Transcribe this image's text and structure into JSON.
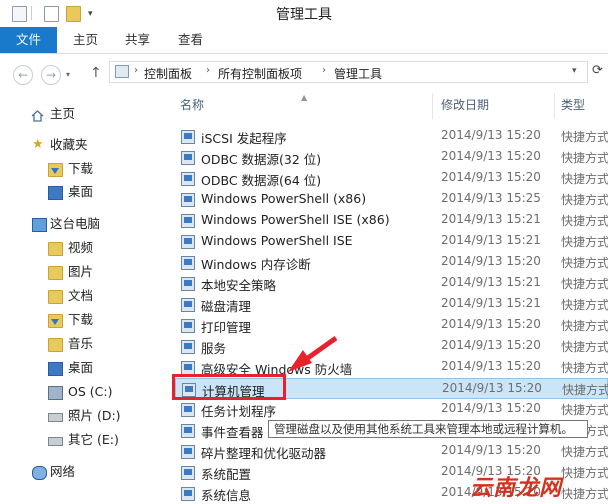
{
  "window": {
    "title": "管理工具"
  },
  "ribbon": {
    "tabs": [
      "文件",
      "主页",
      "共享",
      "查看"
    ]
  },
  "address": {
    "crumbs": [
      "控制面板",
      "所有控制面板项",
      "管理工具"
    ]
  },
  "sidebar": {
    "items": [
      {
        "label": "主页",
        "icon": "home-icon"
      },
      {
        "label": "收藏夹",
        "icon": "star-icon"
      },
      {
        "label": "下载",
        "icon": "download-folder-icon"
      },
      {
        "label": "桌面",
        "icon": "desktop-folder-icon"
      },
      {
        "label": "这台电脑",
        "icon": "computer-icon"
      },
      {
        "label": "视频",
        "icon": "video-folder-icon"
      },
      {
        "label": "图片",
        "icon": "pictures-folder-icon"
      },
      {
        "label": "文档",
        "icon": "documents-folder-icon"
      },
      {
        "label": "下载",
        "icon": "download-folder-icon"
      },
      {
        "label": "音乐",
        "icon": "music-folder-icon"
      },
      {
        "label": "桌面",
        "icon": "desktop-folder-icon"
      },
      {
        "label": "OS (C:)",
        "icon": "windows-drive-icon"
      },
      {
        "label": "照片 (D:)",
        "icon": "drive-icon"
      },
      {
        "label": "其它 (E:)",
        "icon": "drive-icon"
      },
      {
        "label": "网络",
        "icon": "network-icon"
      }
    ]
  },
  "list": {
    "headers": {
      "name": "名称",
      "date": "修改日期",
      "type": "类型"
    },
    "rows": [
      {
        "name": "iSCSI 发起程序",
        "date": "2014/9/13 15:20",
        "type": "快捷方式"
      },
      {
        "name": "ODBC 数据源(32 位)",
        "date": "2014/9/13 15:20",
        "type": "快捷方式"
      },
      {
        "name": "ODBC 数据源(64 位)",
        "date": "2014/9/13 15:20",
        "type": "快捷方式"
      },
      {
        "name": "Windows PowerShell (x86)",
        "date": "2014/9/13 15:25",
        "type": "快捷方式"
      },
      {
        "name": "Windows PowerShell ISE (x86)",
        "date": "2014/9/13 15:21",
        "type": "快捷方式"
      },
      {
        "name": "Windows PowerShell ISE",
        "date": "2014/9/13 15:21",
        "type": "快捷方式"
      },
      {
        "name": "Windows 内存诊断",
        "date": "2014/9/13 15:20",
        "type": "快捷方式"
      },
      {
        "name": "本地安全策略",
        "date": "2014/9/13 15:21",
        "type": "快捷方式"
      },
      {
        "name": "磁盘清理",
        "date": "2014/9/13 15:21",
        "type": "快捷方式"
      },
      {
        "name": "打印管理",
        "date": "2014/9/13 15:20",
        "type": "快捷方式"
      },
      {
        "name": "服务",
        "date": "2014/9/13 15:20",
        "type": "快捷方式"
      },
      {
        "name": "高级安全 Windows 防火墙",
        "date": "2014/9/13 15:20",
        "type": "快捷方式"
      },
      {
        "name": "计算机管理",
        "date": "2014/9/13 15:20",
        "type": "快捷方式"
      },
      {
        "name": "任务计划程序",
        "date": "2014/9/13 15:20",
        "type": "快捷方式"
      },
      {
        "name": "事件查看器",
        "date": "2014/9/13 15:20",
        "type": "快捷方式"
      },
      {
        "name": "碎片整理和优化驱动器",
        "date": "2014/9/13 15:20",
        "type": "快捷方式"
      },
      {
        "name": "系统配置",
        "date": "2014/9/13 15:20",
        "type": "快捷方式"
      },
      {
        "name": "系统信息",
        "date": "2014/9/13 15:20",
        "type": "快捷方式"
      }
    ],
    "selected_index": 12
  },
  "tooltip": {
    "text": "管理磁盘以及使用其他系统工具来管理本地或远程计算机。"
  },
  "watermark": {
    "text": "云南龙网"
  },
  "colors": {
    "accent": "#1979ca",
    "selection": "#cbe5f8",
    "annotation": "#e8222a"
  }
}
